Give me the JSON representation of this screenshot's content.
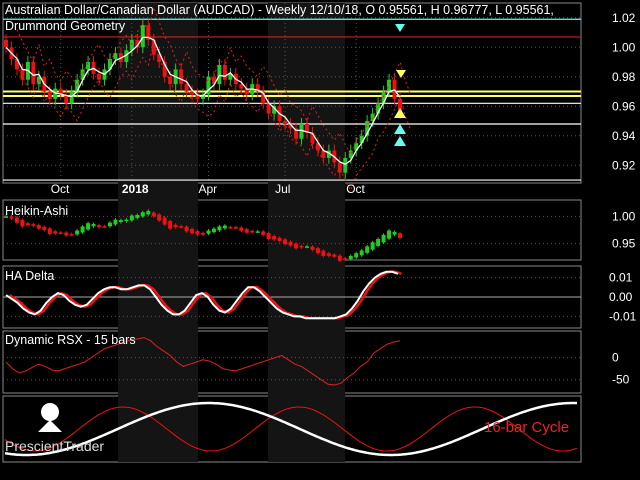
{
  "header": {
    "title": "Australian Dollar/Canadian Dollar (AUDCAD) - Weekly 12/10/18, O 0.95561, H 0.96777, L 0.95561,",
    "subtitle": "Drummond Geometry"
  },
  "watermark": {
    "brand": "PrescientTrader"
  },
  "colors": {
    "up": "#22cc22",
    "down": "#ee1111",
    "ma": "#ffffff",
    "yellow": "#ffff66",
    "cyan": "#66ffee",
    "grid": "#555555",
    "border": "#888888"
  },
  "chart_data": [
    {
      "panel": "price",
      "type": "candlestick",
      "title": "Australian Dollar/Canadian Dollar (AUDCAD) - Weekly 12/10/18, O 0.95561, H 0.96777, L 0.95561,",
      "subtitle": "Drummond Geometry",
      "ylim": [
        0.908,
        1.03
      ],
      "yticks": [
        "1.02",
        "1.00",
        "0.98",
        "0.96",
        "0.94",
        "0.92"
      ],
      "yticks_values": [
        1.02,
        1.0,
        0.98,
        0.96,
        0.94,
        0.92
      ],
      "xticks": [
        "Oct",
        "2018",
        "Apr",
        "Jul",
        "Oct"
      ],
      "xticks_index": [
        10,
        23,
        37,
        51,
        64
      ],
      "close": [
        1.0,
        0.992,
        0.985,
        0.978,
        0.99,
        0.975,
        0.98,
        0.97,
        0.965,
        0.972,
        0.968,
        0.962,
        0.97,
        0.978,
        0.985,
        0.99,
        0.982,
        0.978,
        0.985,
        0.992,
        0.996,
        0.99,
        0.998,
        1.005,
        1.0,
        1.015,
        1.005,
        0.995,
        0.99,
        0.98,
        0.975,
        0.985,
        0.975,
        0.97,
        0.968,
        0.965,
        0.968,
        0.98,
        0.975,
        0.988,
        0.978,
        0.982,
        0.975,
        0.972,
        0.968,
        0.975,
        0.97,
        0.962,
        0.955,
        0.96,
        0.95,
        0.948,
        0.945,
        0.938,
        0.948,
        0.942,
        0.935,
        0.93,
        0.925,
        0.93,
        0.922,
        0.915,
        0.925,
        0.93,
        0.935,
        0.94,
        0.95,
        0.955,
        0.962,
        0.97,
        0.978,
        0.965,
        0.9556
      ],
      "horizontal_lines": [
        {
          "color": "cyan",
          "value": 1.019
        },
        {
          "color": "red",
          "value": 1.007
        },
        {
          "color": "yellow",
          "value": 0.97
        },
        {
          "color": "yellow",
          "value": 0.967
        },
        {
          "color": "white",
          "value": 0.962
        },
        {
          "color": "white",
          "value": 0.948
        },
        {
          "color": "white",
          "value": 0.91
        }
      ]
    },
    {
      "panel": "heikin-ashi",
      "type": "candlestick",
      "title": "Heikin-Ashi",
      "ylim": [
        0.92,
        1.03
      ],
      "yticks": [
        "1.00",
        "0.95"
      ],
      "yticks_values": [
        1.0,
        0.95
      ]
    },
    {
      "panel": "ha-delta",
      "type": "line",
      "title": "HA Delta",
      "ylim": [
        -0.016,
        0.016
      ],
      "yticks": [
        "0.01",
        "0.00",
        "-0.01"
      ],
      "yticks_values": [
        0.01,
        0.0,
        -0.01
      ],
      "series": [
        {
          "values": [
            0.001,
            -0.001,
            -0.003,
            -0.006,
            -0.008,
            -0.009,
            -0.007,
            -0.003,
            0.0,
            0.002,
            0.001,
            -0.002,
            -0.004,
            -0.005,
            -0.004,
            -0.001,
            0.002,
            0.004,
            0.005,
            0.005,
            0.004,
            0.004,
            0.005,
            0.006,
            0.006,
            0.004,
            0.0,
            -0.004,
            -0.007,
            -0.009,
            -0.009,
            -0.007,
            -0.003,
            0.001,
            0.002,
            0.0,
            -0.004,
            -0.007,
            -0.008,
            -0.006,
            -0.002,
            0.002,
            0.005,
            0.005,
            0.003,
            0.0,
            -0.003,
            -0.006,
            -0.008,
            -0.009,
            -0.01,
            -0.01,
            -0.011,
            -0.011,
            -0.011,
            -0.011,
            -0.011,
            -0.011,
            -0.01,
            -0.009,
            -0.006,
            -0.002,
            0.003,
            0.007,
            0.01,
            0.012,
            0.013,
            0.013,
            0.012
          ]
        }
      ]
    },
    {
      "panel": "rsx",
      "type": "line",
      "title": "Dynamic RSX - 15 bars",
      "ylim": [
        -80,
        60
      ],
      "yticks": [
        "0",
        "-50"
      ],
      "yticks_values": [
        0,
        -50
      ],
      "series": [
        {
          "values": [
            -10,
            -25,
            -35,
            -30,
            -22,
            -15,
            -20,
            -28,
            -30,
            -25,
            -20,
            -15,
            -10,
            0,
            10,
            20,
            25,
            30,
            35,
            40,
            42,
            45,
            38,
            25,
            15,
            5,
            -10,
            -20,
            -15,
            -10,
            -5,
            -8,
            -15,
            -25,
            -28,
            -30,
            -25,
            -20,
            -15,
            -10,
            -5,
            0,
            5,
            -5,
            -15,
            -20,
            -30,
            -40,
            -50,
            -60,
            -62,
            -58,
            -45,
            -35,
            -20,
            -10,
            10,
            20,
            30,
            35,
            38
          ]
        }
      ]
    },
    {
      "panel": "cycle",
      "type": "line",
      "title": "",
      "annotation": "16-bar Cycle"
    }
  ]
}
